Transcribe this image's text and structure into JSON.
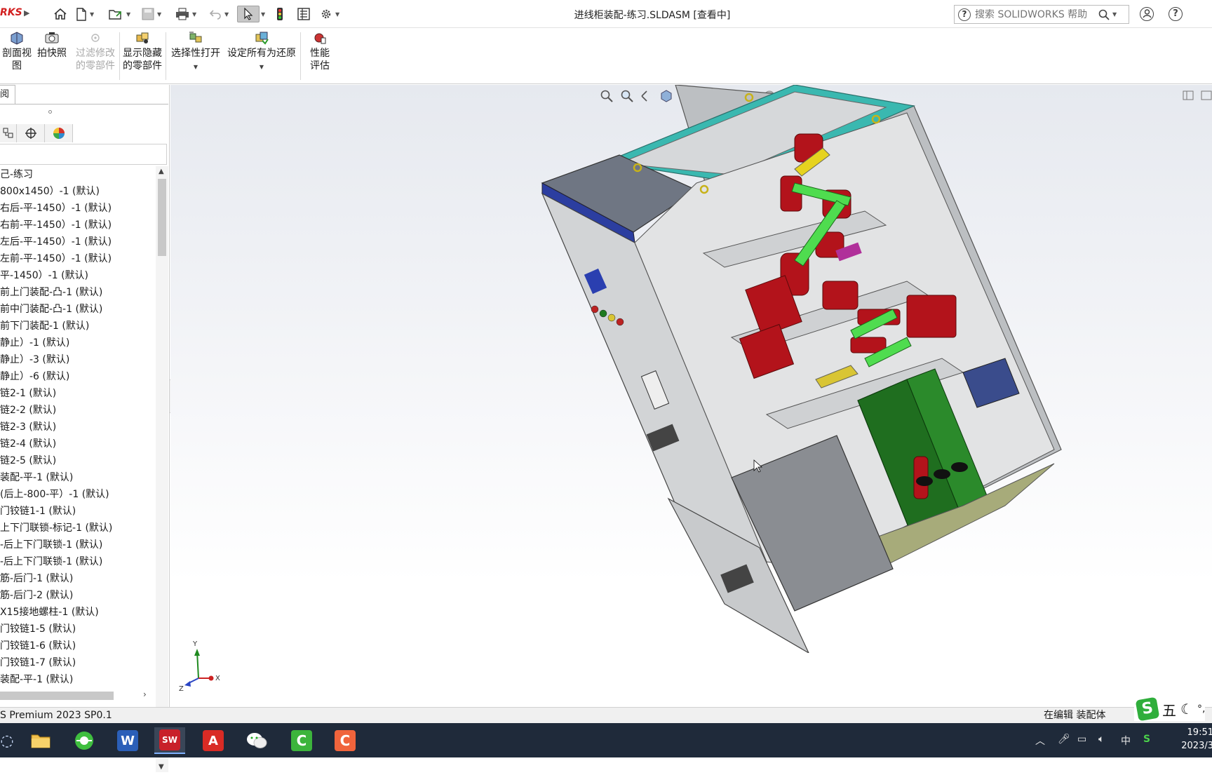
{
  "app": {
    "logo_text": "RKS",
    "document_title": "进线柜装配-练习.SLDASM [查看中]"
  },
  "search": {
    "placeholder": "搜索 SOLIDWORKS 帮助",
    "help_glyph": "?"
  },
  "quick_access": [
    "home",
    "new",
    "open",
    "save",
    "print",
    "undo",
    "select",
    "rebuild",
    "file-properties",
    "options"
  ],
  "ribbon": {
    "section_view": "剖面视图",
    "snapshot": "拍快照",
    "filter_modified": "过滤修改的零部件",
    "show_hidden": "显示隐藏的零部件",
    "selective_open": "选择性打开",
    "set_all_resolved": "设定所有为还原",
    "performance": "性能评估"
  },
  "left_panel": {
    "tab_label": "阅",
    "tree_items": [
      "己-练习",
      "800x1450）-1 (默认)",
      "右后-平-1450）-1 (默认)",
      "右前-平-1450）-1 (默认)",
      "左后-平-1450）-1 (默认)",
      "左前-平-1450）-1 (默认)",
      "平-1450）-1 (默认)",
      "前上门装配-凸-1 (默认)",
      "前中门装配-凸-1 (默认)",
      "前下门装配-1 (默认)",
      "静止）-1 (默认)",
      "静止）-3 (默认)",
      "静止）-6 (默认)",
      "链2-1 (默认)",
      "链2-2 (默认)",
      "链2-3 (默认)",
      "链2-4 (默认)",
      "链2-5 (默认)",
      "装配-平-1 (默认)",
      "(后上-800-平）-1 (默认)",
      "门铰链1-1 (默认)",
      "上下门联锁-标记-1 (默认)",
      "-后上下门联锁-1 (默认)",
      "-后上下门联锁-1 (默认)",
      "筋-后门-1 (默认)",
      "筋-后门-2 (默认)",
      "X15接地螺柱-1 (默认)",
      "门铰链1-5 (默认)",
      "门铰链1-6 (默认)",
      "门铰链1-7 (默认)",
      "装配-平-1 (默认)"
    ]
  },
  "triad": {
    "x": "X",
    "y": "Y",
    "z": "Z"
  },
  "status": {
    "left": "S Premium 2023 SP0.1",
    "right": "在编辑 装配体"
  },
  "ime": {
    "logo": "S",
    "mode": "五"
  },
  "tray": {
    "lang": "中"
  },
  "clock": {
    "time": "19:51",
    "date": "2023/3"
  },
  "colors": {
    "cabinet_gray": "#c9cbcc",
    "busbar_red": "#b3131b",
    "frame_teal": "#3ab8b0",
    "board_green": "#1f6e1f",
    "taskbar": "#1f2a3a"
  }
}
